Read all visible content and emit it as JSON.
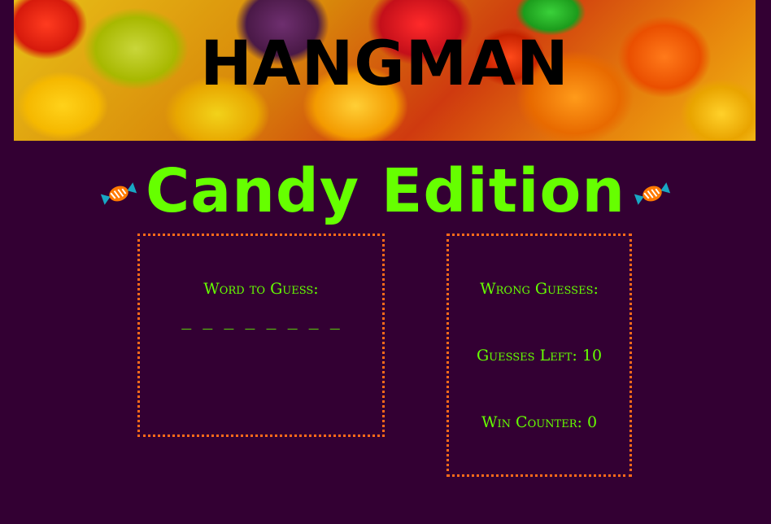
{
  "banner": {
    "title": "HANGMAN"
  },
  "subtitle": {
    "text": "Candy Edition",
    "icon": "candy-icon"
  },
  "word_panel": {
    "label": "Word to Guess:",
    "blanks": "_ _ _ _ _ _ _ _"
  },
  "stats_panel": {
    "wrong_guesses_label": "Wrong Guesses:",
    "guesses_left_text": "Guesses Left: 10",
    "win_counter_text": "Win Counter: 0"
  },
  "colors": {
    "background": "#330033",
    "accent_green": "#66ff00",
    "border_orange": "#ff6a1a"
  }
}
